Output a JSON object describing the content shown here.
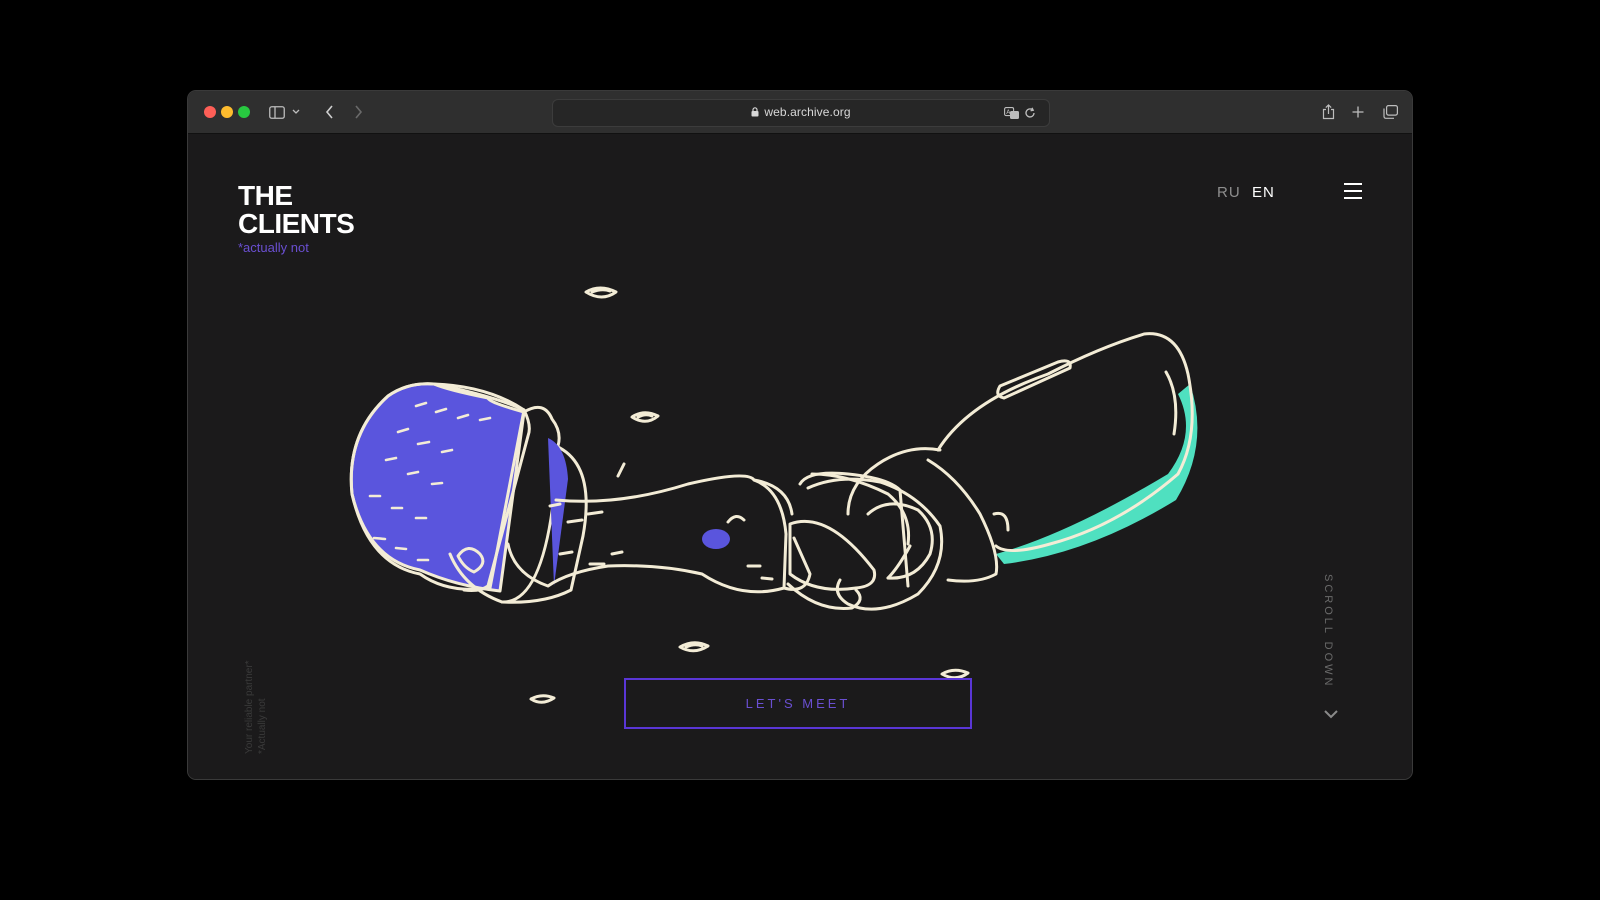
{
  "browser": {
    "url": "web.archive.org"
  },
  "site": {
    "logo_line1": "THE",
    "logo_line2": "CLIENTS",
    "logo_sub": "*actually not",
    "lang_ru": "RU",
    "lang_en": "EN",
    "side_line1": "Your reliable partner*",
    "side_line2": "*Actually not",
    "scroll_label": "SCROLL DOWN",
    "cta_label": "LET'S MEET"
  },
  "colors": {
    "accent_purple": "#5a36d6",
    "accent_teal": "#4fe0c0",
    "line_cream": "#f3ecd6",
    "background": "#1b1a1b"
  },
  "icons": {
    "sidebar": "sidebar-icon",
    "back": "chevron-left-icon",
    "forward": "chevron-right-icon",
    "translate": "translate-icon",
    "reload": "reload-icon",
    "share": "share-icon",
    "new_tab": "plus-icon",
    "tabs": "tabs-overview-icon",
    "menu": "hamburger-menu-icon"
  }
}
